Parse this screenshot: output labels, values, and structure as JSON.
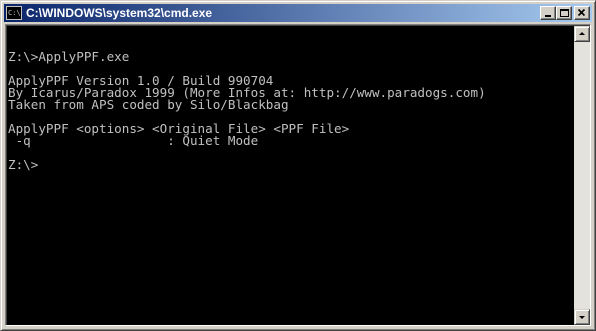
{
  "window": {
    "title": "C:\\WINDOWS\\system32\\cmd.exe",
    "icon": "cmd-icon",
    "icon_text": "C:\\"
  },
  "controls": {
    "minimize_icon": "minimize-icon",
    "maximize_icon": "maximize-icon",
    "close_icon": "close-icon"
  },
  "console": {
    "lines": [
      "",
      "Z:\\>ApplyPPF.exe",
      "",
      "ApplyPPF Version 1.0 / Build 990704",
      "By Icarus/Paradox 1999 (More Infos at: http://www.paradogs.com)",
      "Taken from APS coded by Silo/Blackbag",
      "",
      "ApplyPPF <options> <Original File> <PPF File>",
      " -q                  : Quiet Mode",
      "",
      "Z:\\>"
    ]
  },
  "colors": {
    "console_bg": "#000000",
    "console_fg": "#c0c0c0",
    "title_gradient_start": "#0a246a",
    "title_gradient_end": "#a6caf0"
  }
}
